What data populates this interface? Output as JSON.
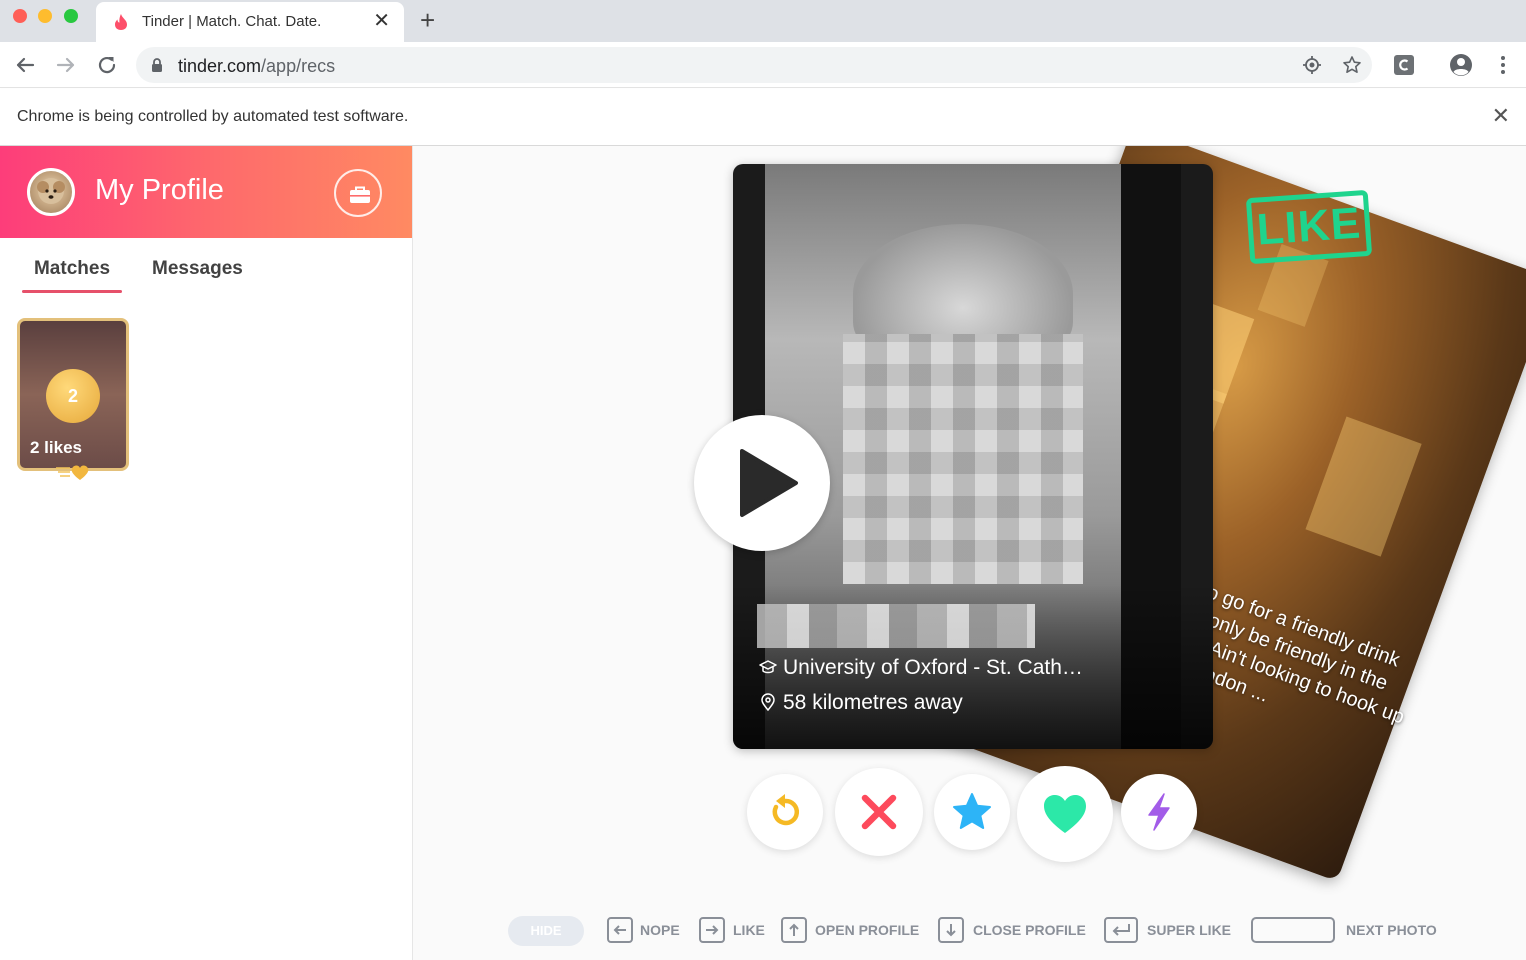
{
  "browser": {
    "tab_title": "Tinder | Match. Chat. Date.",
    "tab_close": "✕",
    "new_tab": "+",
    "url_host": "tinder.com",
    "url_path": "/app/recs",
    "infobar_text": "Chrome is being controlled by automated test software.",
    "infobar_close": "✕"
  },
  "sidebar": {
    "profile_title": "My Profile",
    "tabs": [
      {
        "label": "Matches",
        "active": true
      },
      {
        "label": "Messages",
        "active": false
      }
    ],
    "likes_count": "2",
    "likes_label": "2 likes"
  },
  "card": {
    "school": "University of Oxford - St. Cath…",
    "distance": "58 kilometres away",
    "like_stamp": "LIKE",
    "back_bio": "Anyone want to go for a friendly drink tonight that will only be friendly in the central London? Ain't looking to hook up just btw. From London ..."
  },
  "actions": {
    "icons": [
      "rewind-icon",
      "nope-icon",
      "super-like-icon",
      "like-icon",
      "boost-icon"
    ]
  },
  "shortcuts": {
    "hide": "HIDE",
    "nope": "NOPE",
    "like": "LIKE",
    "open_profile": "OPEN PROFILE",
    "close_profile": "CLOSE PROFILE",
    "super_like": "SUPER LIKE",
    "next_photo": "NEXT PHOTO"
  },
  "colors": {
    "brand_gradient_start": "#fd3d7a",
    "brand_gradient_end": "#ff8a62",
    "like_green": "#1fd48d",
    "nope_red": "#fd4a5c",
    "super_blue": "#2db4f7",
    "boost_purple": "#a25ce8",
    "rewind_yellow": "#f5b924"
  }
}
